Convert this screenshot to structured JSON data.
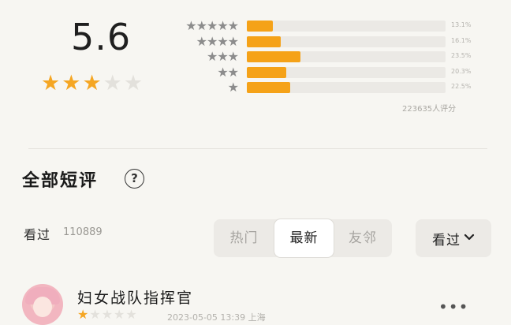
{
  "rating": {
    "score": "5.6",
    "stars": [
      1,
      1,
      1,
      0,
      0
    ],
    "distribution": [
      {
        "stars": "★★★★★",
        "fraction": 0.13,
        "percent": "13.1%"
      },
      {
        "stars": "★★★★",
        "fraction": 0.17,
        "percent": "16.1%"
      },
      {
        "stars": "★★★",
        "fraction": 0.27,
        "percent": "23.5%"
      },
      {
        "stars": "★★",
        "fraction": 0.2,
        "percent": "20.3%"
      },
      {
        "stars": "★",
        "fraction": 0.22,
        "percent": "22.5%"
      }
    ],
    "count_text": "223635人评分"
  },
  "comments": {
    "title": "全部短评",
    "help_icon": "question-circle-icon",
    "seen_label": "看过",
    "seen_count": "110889",
    "tabs": [
      "热门",
      "最新",
      "友邻"
    ],
    "active_tab": "最新",
    "filter_label": "看过",
    "filter_icon": "chevron-down-icon"
  },
  "review": {
    "username": "妇女战队指挥官",
    "stars": [
      1,
      0,
      0,
      0,
      0
    ],
    "timestamp": "2023-05-05 13:39 上海",
    "more_icon": "more-icon"
  },
  "colors": {
    "accent": "#f5a218",
    "background": "#f7f6f2"
  }
}
